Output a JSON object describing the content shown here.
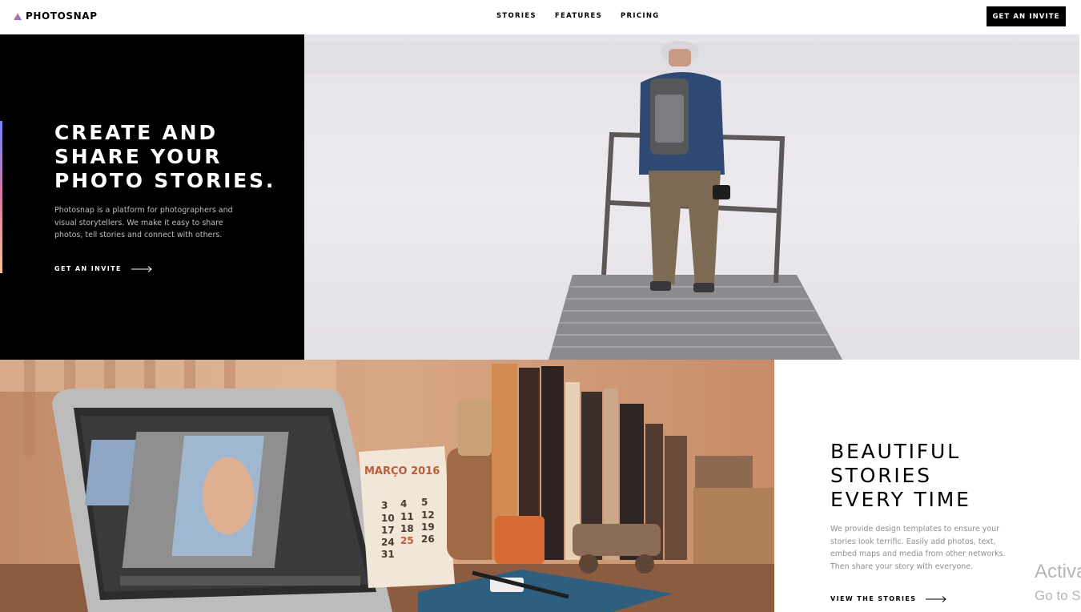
{
  "brand": {
    "name": "PHOTOSNAP"
  },
  "nav": {
    "items": [
      "STORIES",
      "FEATURES",
      "PRICING"
    ]
  },
  "header": {
    "cta_label": "GET AN INVITE"
  },
  "hero": {
    "title": "CREATE AND\nSHARE YOUR\nPHOTO STORIES.",
    "description": "Photosnap is a platform for photographers and visual storytellers. We make it easy to share photos, tell stories and connect with others.",
    "link_label": "GET AN INVITE"
  },
  "stories": {
    "title": "BEAUTIFUL\nSTORIES\nEVERY TIME",
    "description": "We provide design templates to ensure your stories look terrific. Easily add photos, text, embed maps and media from other networks. Then share your story with everyone.",
    "link_label": "VIEW THE STORIES",
    "calendar_month": "MARÇO 2016",
    "calendar_days": [
      "3",
      "4",
      "5",
      "10",
      "11",
      "12",
      "17",
      "18",
      "19",
      "24",
      "25",
      "26",
      "31"
    ]
  },
  "watermark": {
    "line1": "Activa",
    "line2": "Go to S"
  },
  "colors": {
    "accent_gradient": [
      "#7086f5",
      "#d87ba3",
      "#f3c493"
    ],
    "dark": "#000000"
  }
}
